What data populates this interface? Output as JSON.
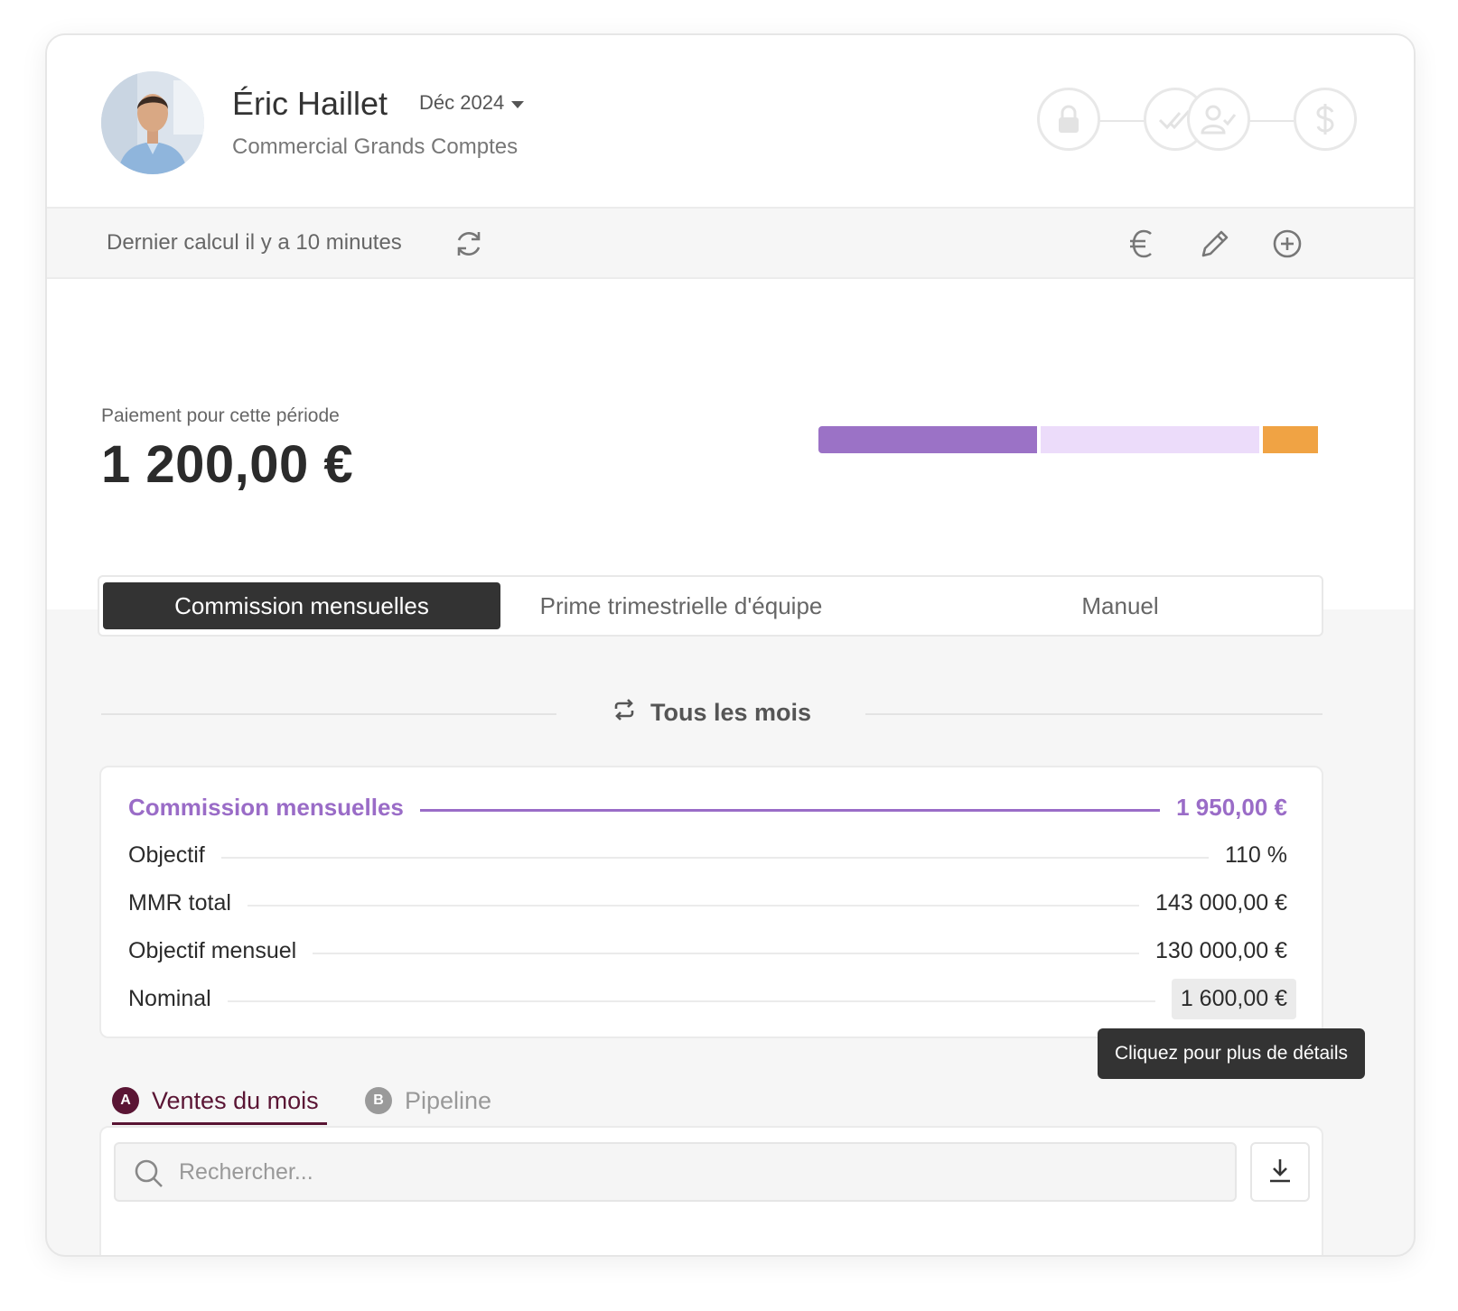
{
  "user": {
    "name": "Éric Haillet",
    "role": "Commercial Grands Comptes",
    "period": "Déc 2024"
  },
  "status_steps": [
    "lock-icon",
    "double-check-icon",
    "user-check-icon",
    "dollar-icon"
  ],
  "toolbar": {
    "last_calc": "Dernier calcul il y a 10 minutes",
    "icons": [
      "refresh-icon",
      "euro-icon",
      "pencil-icon",
      "plus-circle-icon"
    ]
  },
  "payout": {
    "label": "Paiement pour cette période",
    "amount": "1 200,00 €",
    "bar": [
      {
        "fraction": 0.44,
        "color": "#9b72c6"
      },
      {
        "fraction": 0.44,
        "color": "#ecdcfa"
      },
      {
        "fraction": 0.11,
        "color": "#f0a344"
      }
    ]
  },
  "tabs": [
    {
      "label": "Commission mensuelles",
      "active": true
    },
    {
      "label": "Prime trimestrielle d'équipe",
      "active": false
    },
    {
      "label": "Manuel",
      "active": false
    }
  ],
  "recurrence": {
    "label": "Tous les mois"
  },
  "detail": {
    "title": "Commission mensuelles",
    "total": "1 950,00 €",
    "rows": [
      {
        "label": "Objectif",
        "value": "110 %"
      },
      {
        "label": "MMR total",
        "value": "143 000,00 €"
      },
      {
        "label": "Objectif mensuel",
        "value": "130 000,00 €"
      },
      {
        "label": "Nominal",
        "value": "1 600,00 €"
      }
    ]
  },
  "tooltip": "Cliquez pour plus de détails",
  "subtabs": [
    {
      "badge": "A",
      "label": "Ventes du mois",
      "active": true
    },
    {
      "badge": "B",
      "label": "Pipeline",
      "active": false
    }
  ],
  "search": {
    "placeholder": "Rechercher..."
  },
  "colors": {
    "accent": "#9b72c6",
    "dark": "#333333",
    "subtab_active": "#5a1534",
    "warning": "#f0a344"
  }
}
